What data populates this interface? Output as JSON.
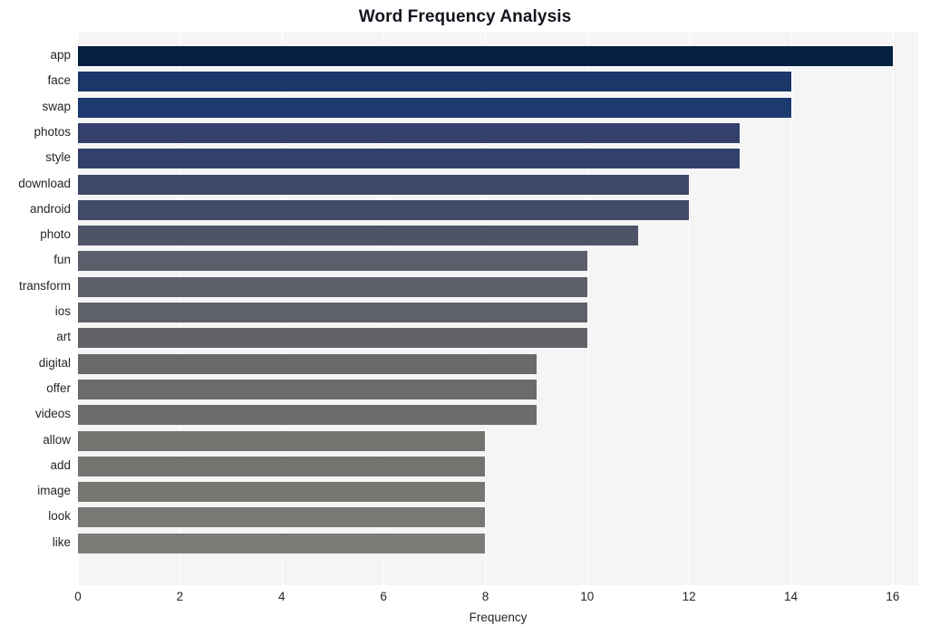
{
  "chart_data": {
    "type": "bar",
    "orientation": "horizontal",
    "title": "Word Frequency Analysis",
    "xlabel": "Frequency",
    "ylabel": "",
    "xlim": [
      0,
      16.5
    ],
    "xticks": [
      0,
      2,
      4,
      6,
      8,
      10,
      12,
      14,
      16
    ],
    "xtick_labels": [
      "0",
      "2",
      "4",
      "6",
      "8",
      "10",
      "12",
      "14",
      "16"
    ],
    "grid": "vertical-white-on-light",
    "legend": null,
    "categories": [
      "app",
      "face",
      "swap",
      "photos",
      "style",
      "download",
      "android",
      "photo",
      "fun",
      "transform",
      "ios",
      "art",
      "digital",
      "offer",
      "videos",
      "allow",
      "add",
      "image",
      "look",
      "like"
    ],
    "values": [
      16,
      14,
      14,
      13,
      13,
      12,
      12,
      11,
      10,
      10,
      10,
      10,
      9,
      9,
      9,
      8,
      8,
      8,
      8,
      8
    ],
    "bar_colors": [
      "#04203f",
      "#1b3668",
      "#1d3a70",
      "#33406c",
      "#334069",
      "#3f4868",
      "#414a68",
      "#4e5468",
      "#5b5f6c",
      "#5d6069",
      "#5f6169",
      "#616369",
      "#686a6c",
      "#696b6c",
      "#6a6c6d",
      "#73736f",
      "#747471",
      "#767672",
      "#787874",
      "#7b7b77"
    ],
    "plot_background": "#f5f5f6",
    "figure_background": "#ffffff",
    "gridline_color": "#ffffff",
    "text_color": "#262626",
    "title_color": "#14161f"
  }
}
